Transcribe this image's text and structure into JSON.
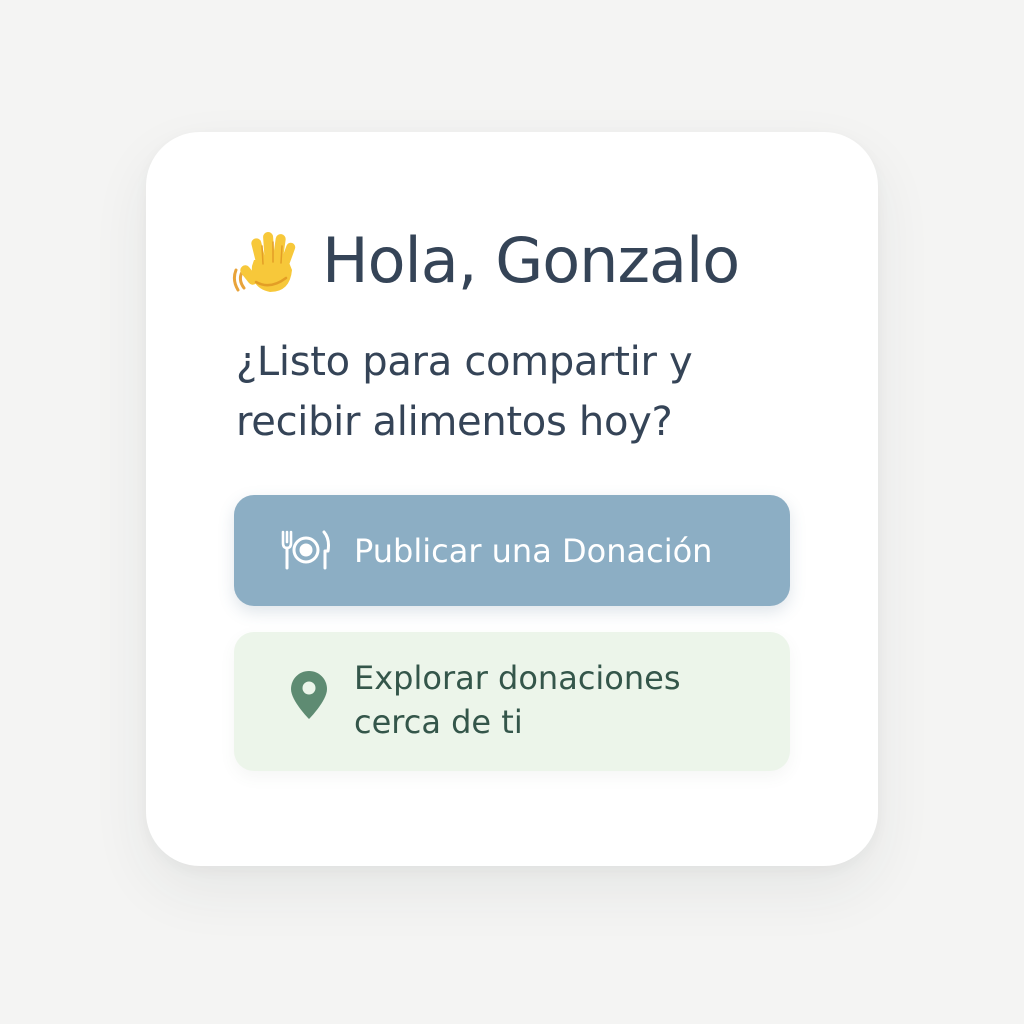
{
  "greeting": {
    "icon": "waving-hand-icon",
    "text": "Hola, Gonzalo"
  },
  "subtitle": "¿Listo para compartir y recibir alimentos hoy?",
  "actions": {
    "publish": {
      "icon": "fork-plate-knife-icon",
      "label": "Publicar una Donación"
    },
    "explore": {
      "icon": "location-pin-icon",
      "label": "Explorar donaciones cerca de ti"
    }
  },
  "colors": {
    "background": "#f4f4f3",
    "card": "#ffffff",
    "text": "#354457",
    "primary_button": "#8caec4",
    "secondary_button": "#ecf5ea",
    "secondary_text": "#34564a",
    "pin": "#5e8b72"
  }
}
